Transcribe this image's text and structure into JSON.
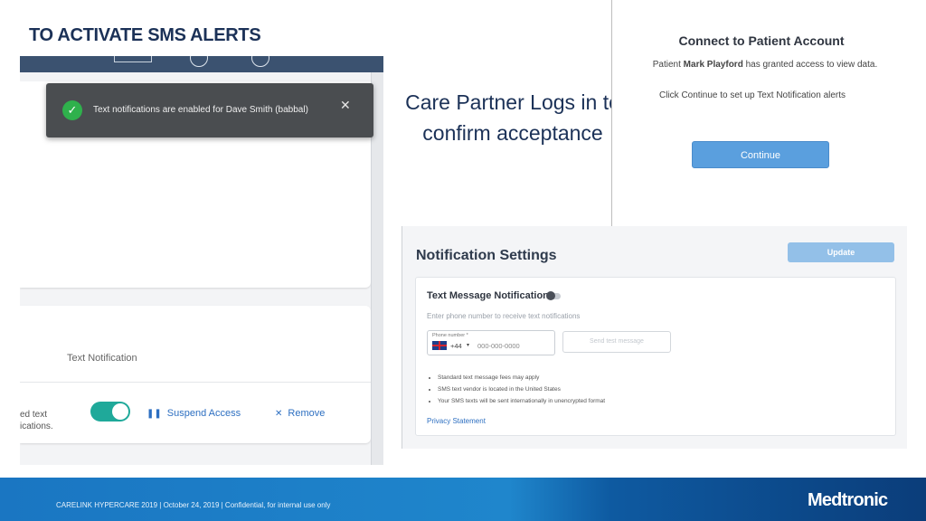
{
  "slide": {
    "title": "TO ACTIVATE SMS ALERTS",
    "caption_line1": "Care Partner Logs in to",
    "caption_line2": "confirm acceptance"
  },
  "left_screenshot": {
    "toast": {
      "icon": "check-circle-icon",
      "message": "Text notifications are enabled for Dave Smith (babbal)",
      "close_glyph": "✕"
    },
    "column_header": "Text Notification",
    "row": {
      "cut_text_line1": "ed text",
      "cut_text_line2": "ications.",
      "toggle_on": true,
      "suspend_label": "Suspend Access",
      "suspend_icon_glyph": "❚❚",
      "remove_label": "Remove",
      "remove_icon_glyph": "✕"
    },
    "colors": {
      "toast_bg": "#4a4d50",
      "toggle_on": "#1fa99a",
      "link": "#2d6fc1",
      "topbar": "#3b5270"
    }
  },
  "connect_screenshot": {
    "title": "Connect to Patient Account",
    "line1_prefix": "Patient ",
    "line1_name": "Mark Playford",
    "line1_suffix": " has granted access to view data.",
    "line2": "Click Continue to set up Text Notification alerts",
    "continue_label": "Continue",
    "colors": {
      "button": "#5a9fde"
    }
  },
  "notification_settings": {
    "title": "Notification Settings",
    "update_label": "Update",
    "text_message_title": "Text Message Notification",
    "text_message_enabled": false,
    "subtitle": "Enter phone number to receive text notifications",
    "phone": {
      "label": "Phone number *",
      "country_code": "+44",
      "caret": "▾",
      "placeholder": "000-000-0000"
    },
    "send_test_label": "Send test message",
    "bullets": [
      "Standard text message fees may apply",
      "SMS text vendor is located in the United States",
      "Your SMS texts will be sent internationally in unencrypted format"
    ],
    "privacy_label": "Privacy Statement"
  },
  "footer": {
    "text": "CARELINK HYPERCARE 2019  |  October 24, 2019  |  Confidential, for internal use only",
    "logo": "Medtronic"
  }
}
